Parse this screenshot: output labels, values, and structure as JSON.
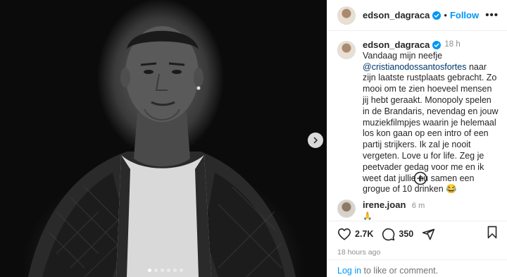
{
  "post": {
    "username": "edson_dagraca",
    "follow_label": "Follow",
    "separator": "•",
    "more_label": "•••",
    "time_ago": "18 h",
    "caption_pre": "Vandaag mijn neefje ",
    "mention": "@cristianodossantosfortes",
    "caption_post": " naar zijn laatste rustplaats gebracht. Zo mooi om te zien hoeveel mensen jij hebt geraakt. Monopoly spelen in de Brandaris, nevendag en jouw muziekfilmpjes waarin je helemaal los kon gaan op een intro of een partij strijkers. Ik zal je nooit vergeten. Love u for life. Zeg je peetvader gedag voor me en ik weet dat jullie nu samen een grogue of 10 drinken 😂"
  },
  "comment": {
    "username": "irene.joan",
    "time_ago": "6 m",
    "text": "🙏"
  },
  "actions": {
    "likes": "2.7K",
    "comments": "350",
    "date": "18 hours ago"
  },
  "login": {
    "link_label": "Log in",
    "suffix": " to like or comment."
  },
  "carousel": {
    "total_slides": 6,
    "active_slide": 1
  },
  "colors": {
    "accent": "#0095f6",
    "verified": "#0095f6",
    "mention": "#00376b",
    "muted": "#8e8e8e"
  },
  "icons": [
    "verified-badge-icon",
    "chevron-right-icon",
    "plus-circle-icon",
    "heart-icon",
    "comment-icon",
    "share-icon",
    "bookmark-icon"
  ]
}
